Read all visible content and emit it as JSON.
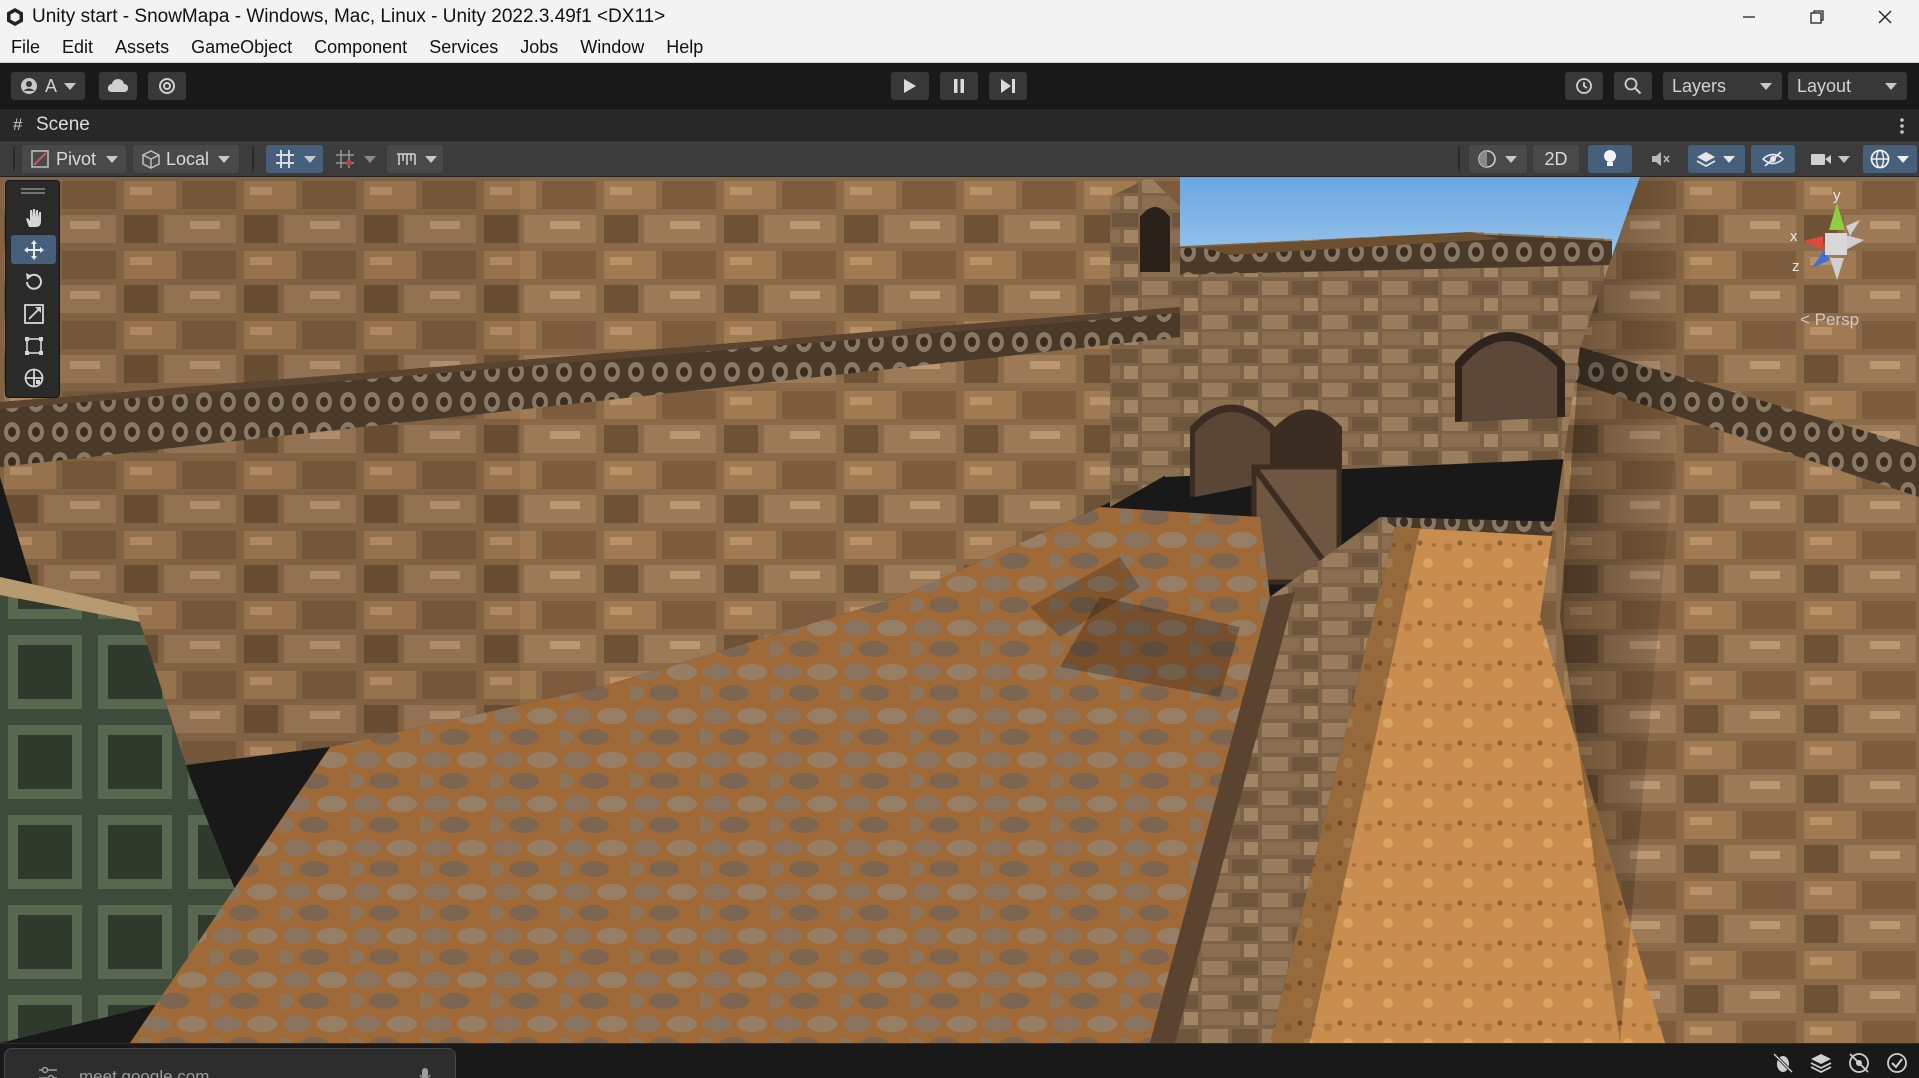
{
  "window": {
    "title": "Unity start - SnowMapa - Windows, Mac, Linux - Unity 2022.3.49f1 <DX11>",
    "icons": [
      "unity-logo-icon",
      "minimize-icon",
      "restore-icon",
      "close-icon"
    ]
  },
  "menu": {
    "items": [
      "File",
      "Edit",
      "Assets",
      "GameObject",
      "Component",
      "Services",
      "Jobs",
      "Window",
      "Help"
    ]
  },
  "toolbar": {
    "account_label": "A",
    "play_controls": [
      "play-icon",
      "pause-icon",
      "step-icon"
    ],
    "layers_label": "Layers",
    "layout_label": "Layout"
  },
  "scene_tab": {
    "label": "Scene"
  },
  "scene_toolbar": {
    "pivot_label": "Pivot",
    "local_label": "Local",
    "mode_2d_label": "2D"
  },
  "viewport": {
    "gizmo": {
      "axis_y": "y",
      "axis_x": "x",
      "axis_z": "z",
      "projection_label": "< Persp"
    },
    "tools": [
      "hand-tool",
      "move-tool",
      "rotate-tool",
      "scale-tool",
      "rect-tool",
      "transform-tool"
    ],
    "active_tool": "move-tool"
  },
  "bottom": {
    "url_text": "meet.google.com"
  },
  "colors": {
    "editor_dark": "#191919",
    "toolbar_gray": "#3c3c3c",
    "active_blue": "#46607c",
    "sky": "#8cc0ee",
    "stone": "#8a6a48",
    "sand": "#c98e4f"
  }
}
